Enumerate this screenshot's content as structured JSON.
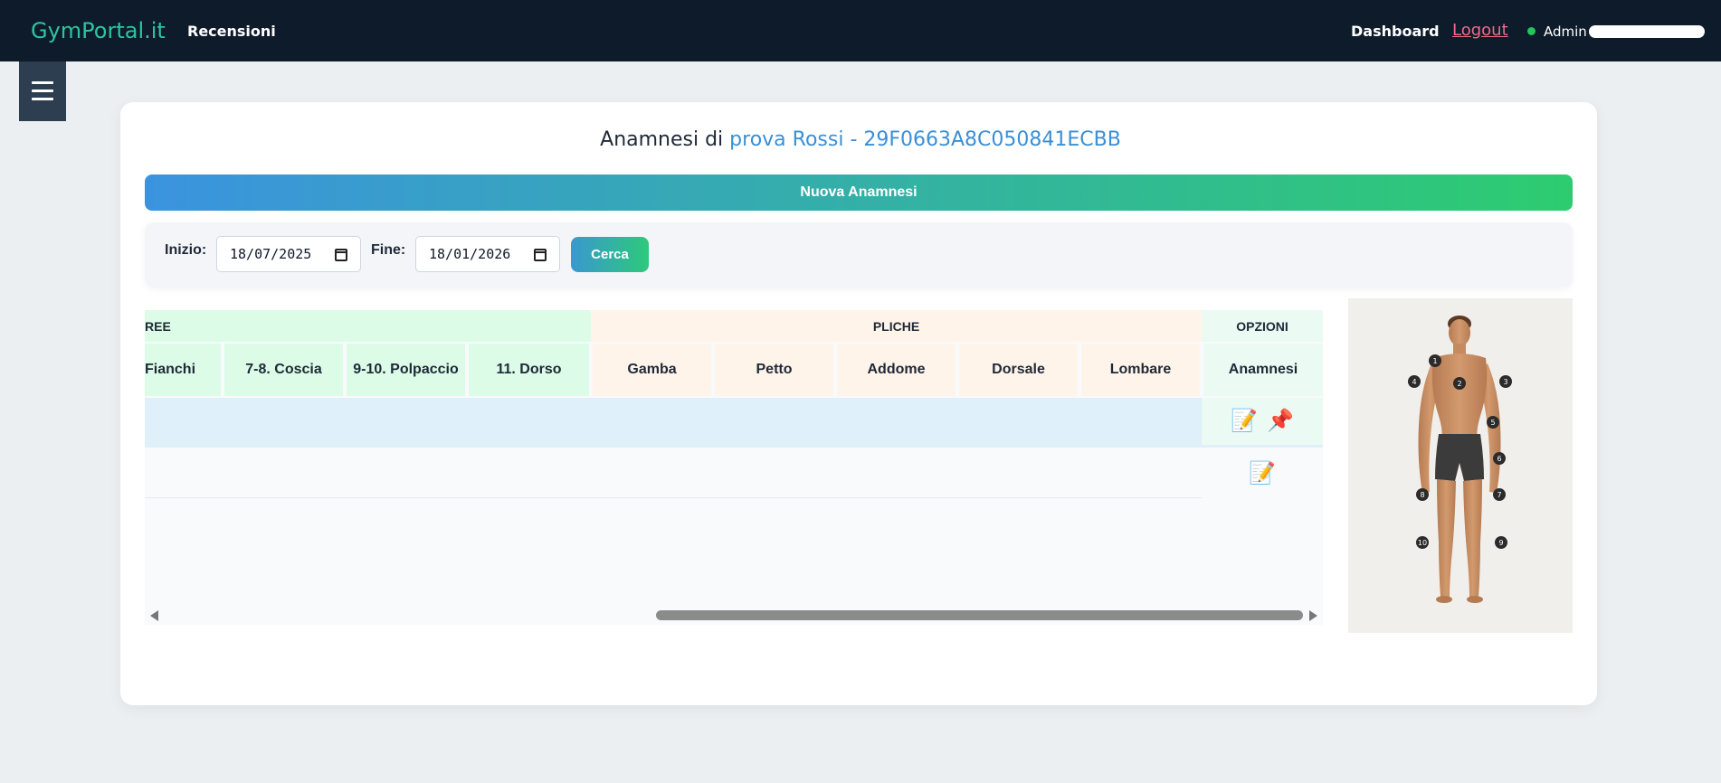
{
  "navbar": {
    "brand": "GymPortal.it",
    "reviews_link": "Recensioni",
    "dashboard_link": "Dashboard",
    "logout_link": "Logout",
    "user_label": "Admin"
  },
  "page": {
    "title_prefix": "Anamnesi di ",
    "title_client": "prova Rossi - 29F0663A8C050841ECBB"
  },
  "new_button": "Nuova Anamnesi",
  "filters": {
    "start_label": "Inizio:",
    "start_value": "18/07/2025",
    "end_label": "Fine:",
    "end_value": "18/01/2026",
    "search_label": "Cerca"
  },
  "table": {
    "groups": [
      {
        "label": "REE",
        "color": "#dcfce8"
      },
      {
        "label": "PLICHE",
        "color": "#fff4ea"
      },
      {
        "label": "OPZIONI",
        "color": "#ebfbf3"
      }
    ],
    "columns": [
      "Fianchi",
      "7-8. Coscia",
      "9-10. Polpaccio",
      "11. Dorso",
      "Gamba",
      "Petto",
      "Addome",
      "Dorsale",
      "Lombare",
      "Anamnesi"
    ],
    "rows": [
      {
        "actions": [
          "edit-icon",
          "pin-icon"
        ],
        "highlighted": true
      },
      {
        "actions": [
          "edit-icon"
        ],
        "highlighted": false
      }
    ]
  },
  "body_map": {
    "markers": [
      "1",
      "2",
      "3",
      "4",
      "5",
      "6",
      "7",
      "8",
      "9",
      "10"
    ]
  },
  "colors": {
    "navbar_bg": "#0d1b2a",
    "brand": "#2ec4a0",
    "accent_blue": "#3a8fd6",
    "accent_green": "#2dcc70",
    "logout": "#f06b8a",
    "online": "#22c55e"
  }
}
